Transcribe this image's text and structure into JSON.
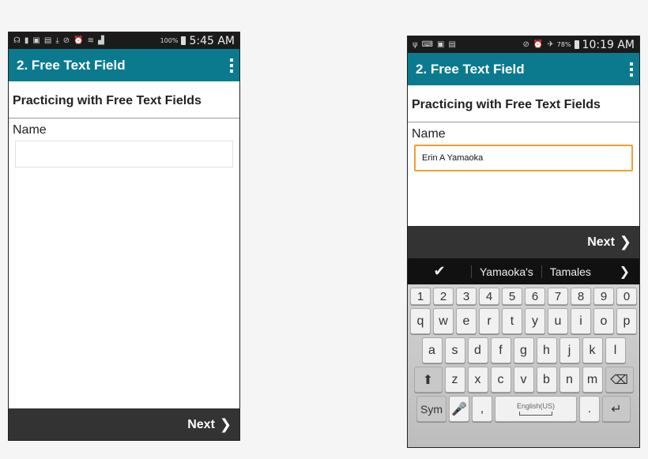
{
  "screens": [
    {
      "status": {
        "icons": [
          "headset-icon",
          "phone-icon",
          "sim-icon",
          "image-icon",
          "download-icon",
          "mute-icon",
          "alarm-icon",
          "wifi-icon",
          "signal-icon"
        ],
        "battery": "100%",
        "time": "5:45 AM"
      },
      "app_title": "2. Free Text Field",
      "section_title": "Practicing with Free Text Fields",
      "field_label": "Name",
      "field_value": "",
      "next_label": "Next"
    },
    {
      "status": {
        "icons": [
          "usb-icon",
          "keyboard-icon",
          "sim-icon",
          "image-icon",
          "mute-icon",
          "alarm-icon",
          "airplane-icon"
        ],
        "battery": "78%",
        "time": "10:19 AM"
      },
      "app_title": "2. Free Text Field",
      "section_title": "Practicing with Free Text Fields",
      "field_label": "Name",
      "field_value": "Erin A Yamaoka",
      "next_label": "Next",
      "suggestions": [
        "Yamaoka's",
        "Tamales"
      ],
      "keyboard": {
        "numbers": [
          "1",
          "2",
          "3",
          "4",
          "5",
          "6",
          "7",
          "8",
          "9",
          "0"
        ],
        "row1": [
          "q",
          "w",
          "e",
          "r",
          "t",
          "y",
          "u",
          "i",
          "o",
          "p"
        ],
        "row2": [
          "a",
          "s",
          "d",
          "f",
          "g",
          "h",
          "j",
          "k",
          "l"
        ],
        "row3": [
          "z",
          "x",
          "c",
          "v",
          "b",
          "n",
          "m"
        ],
        "sym_label": "Sym",
        "comma": ",",
        "period": ".",
        "space_label": "English(US)"
      }
    }
  ],
  "colors": {
    "appbar": "#0b7a8f",
    "focus_border": "#f0a030",
    "nextbar": "#333333"
  }
}
